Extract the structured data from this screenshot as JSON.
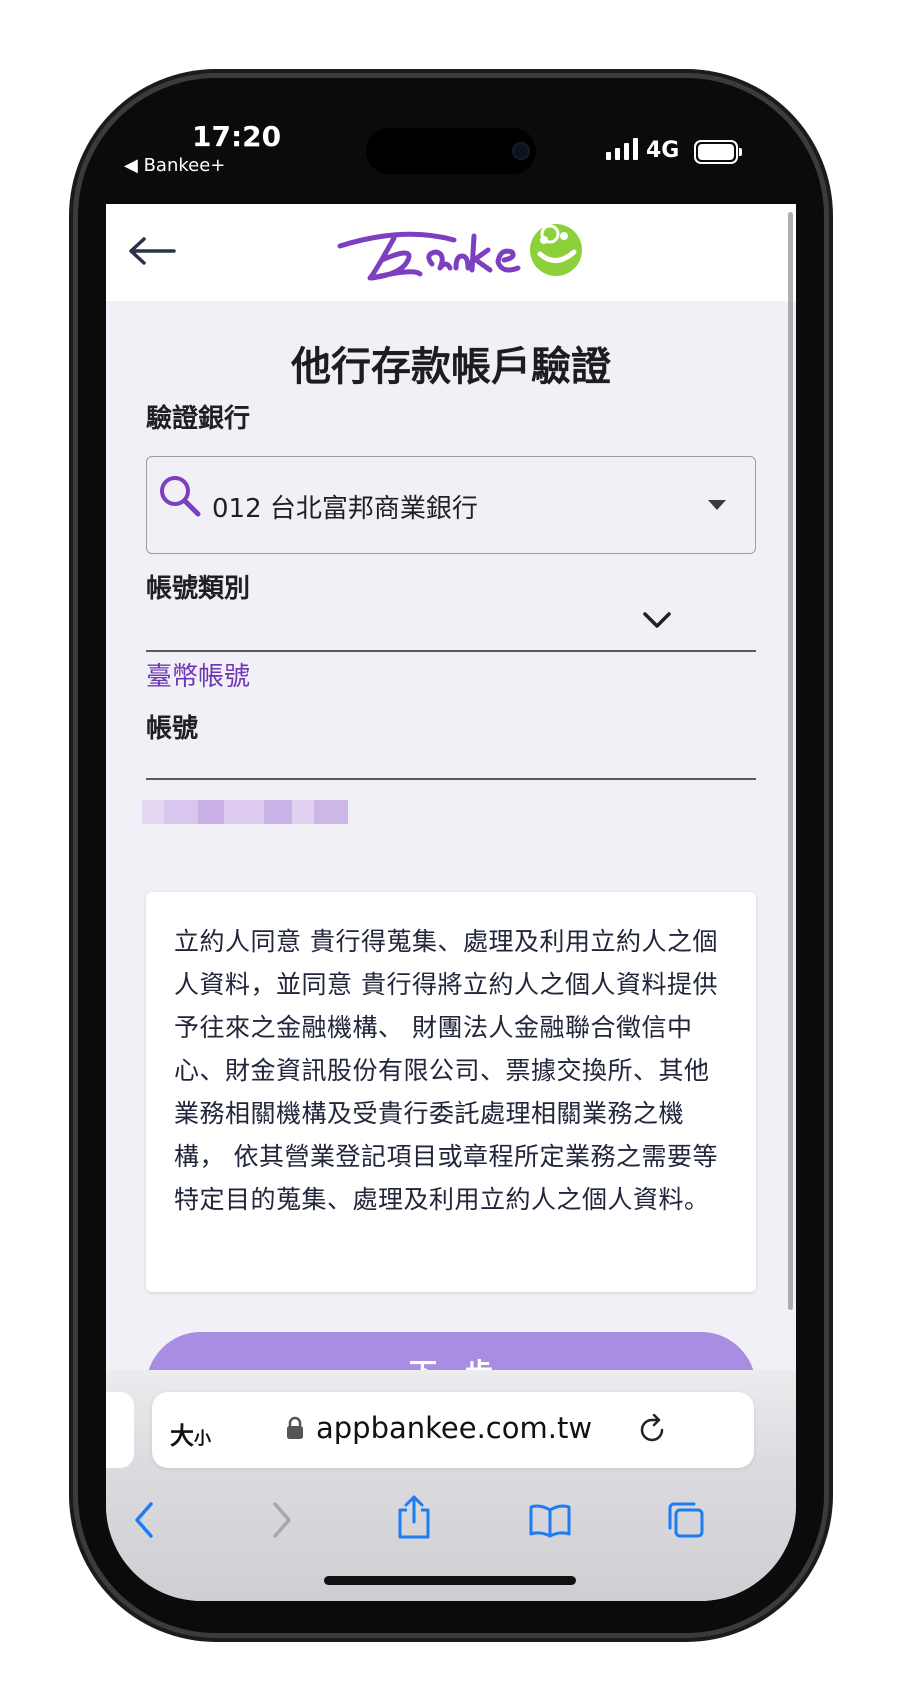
{
  "status_bar": {
    "time": "17:20",
    "back_app": "◀ Bankee+",
    "network": "4G"
  },
  "header": {
    "back_icon": "arrow-left-icon",
    "logo": "Bankee"
  },
  "page": {
    "title": "他行存款帳戶驗證"
  },
  "form": {
    "bank_label": "驗證銀行",
    "bank_value": "012 台北富邦商業銀行",
    "type_label": "帳號類別",
    "type_value": "臺幣帳號",
    "account_label": "帳號",
    "account_value_masked": true
  },
  "consent_text": "立約人同意 貴行得蒐集、處理及利用立約人之個人資料，並同意 貴行得將立約人之個人資料提供予往來之金融機構、 財團法人金融聯合徵信中心、財金資訊股份有限公司、票據交換所、其他業務相關機構及受貴行委託處理相關業務之機構， 依其營業登記項目或章程所定業務之需要等特定目的蒐集、處理及利用立約人之個人資料。",
  "next_button": "下一步",
  "safari": {
    "text_size_label": "大",
    "text_size_small": "小",
    "url": "appbankee.com.tw"
  },
  "colors": {
    "brand_purple": "#6f37b5",
    "brand_green": "#8cd13a",
    "button": "#a88de2"
  }
}
